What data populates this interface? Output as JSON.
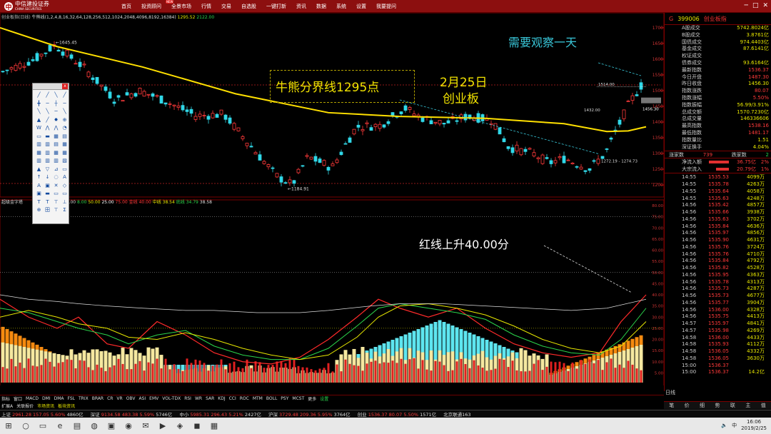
{
  "app": {
    "logo_cn": "中信建投证券",
    "logo_en": "CHINA SECURITIES",
    "menu": [
      "首页",
      "投资顾问",
      "全景市场",
      "行情",
      "交易",
      "自选股",
      "一键打新",
      "资讯",
      "数据",
      "系统",
      "设置",
      "我要提问"
    ],
    "menu_badge": "NEW",
    "win_buttons": [
      "─",
      "□",
      "✕"
    ]
  },
  "chart": {
    "param_line": {
      "name": "创业板指(日线)",
      "indicator": "牛熊线(1,2,4,8,16,32,64,128,256,512,1024,2048,4096,8192,16384)",
      "v1": "1295.52",
      "v2": "2122.00"
    },
    "price_axis": [
      "1700",
      "1650",
      "1600",
      "1550",
      "1500",
      "1450",
      "1400",
      "1350",
      "1300",
      "1250",
      "1200"
    ],
    "price_labels": {
      "high_mark": "1645.45",
      "low_mark": "1184.91",
      "l1514": "1514.00",
      "l1432": "1432.00",
      "l1456": "1456.30",
      "range": "1272.19 - 1274.73"
    },
    "ind_line": {
      "name": "超级金字塔",
      "a": "12.00",
      "b": "8.00",
      "c": "50.00",
      "d": "25.00",
      "e": "75.00",
      "gold_label": "金线",
      "gold_val": "40.00",
      "mid_label": "中线",
      "mid_val": "38.54",
      "low_label": "底线",
      "low_val": "34.79",
      "x": "38.58"
    },
    "ind_axis": [
      "80.00",
      "75.00",
      "70.00",
      "65.00",
      "60.00",
      "55.00",
      "50.00",
      "45.00",
      "40.00",
      "35.00",
      "30.00",
      "25.00",
      "20.00",
      "15.00",
      "10.00",
      "5.00"
    ],
    "date_marks": [
      "12",
      "1",
      "2"
    ]
  },
  "annotations": {
    "box_text": "牛熊分界线1295点",
    "date_text": "2月25日",
    "board_text": "创业板",
    "observe_text": "需要观察一天",
    "red_line_text": "红线上升40.00分"
  },
  "drawtool": {
    "close": "x",
    "tools": [
      "╱",
      "╱",
      "╲",
      "╱",
      "╋",
      "─",
      "┼",
      "─",
      "╲",
      "╲",
      "─",
      "╲",
      "▲",
      "╱",
      "✸",
      "⊕",
      "W",
      "⋀",
      "⋀",
      "◔",
      "▭",
      "▬",
      "▦",
      "▤",
      "▥",
      "▥",
      "▤",
      "▦",
      "▦",
      "▥",
      "▦",
      "▦",
      "▥",
      "▥",
      "▥",
      "▧",
      "▲",
      "▽",
      "⊿",
      "▭",
      "↑",
      "↓",
      "◌",
      "A",
      "A",
      "▣",
      "✕",
      "◇",
      "▣",
      "▬",
      "▭",
      "▭",
      "T",
      "T",
      "⊤",
      "⊥",
      "⊕",
      "田",
      "⊤",
      "Σ"
    ]
  },
  "quote": {
    "code": "399006",
    "name": "创业板指",
    "g": "G",
    "rows": [
      {
        "l": "A股成交",
        "v": "5742.8024亿",
        "c": ""
      },
      {
        "l": "B股成交",
        "v": "3.8761亿",
        "c": ""
      },
      {
        "l": "国债成交",
        "v": "974.4403亿",
        "c": ""
      },
      {
        "l": "基金成交",
        "v": "87.6141亿",
        "c": ""
      },
      {
        "l": "权证成交",
        "v": "",
        "c": ""
      },
      {
        "l": "债券成交",
        "v": "93.6164亿",
        "c": ""
      },
      {
        "l": "最新指数",
        "v": "1536.37",
        "c": "red"
      },
      {
        "l": "今日开盘",
        "v": "1487.30",
        "c": "red"
      },
      {
        "l": "昨日收盘",
        "v": "1456.30",
        "c": ""
      },
      {
        "l": "指数涨跌",
        "v": "80.07",
        "c": "red"
      },
      {
        "l": "指数涨幅",
        "v": "5.50%",
        "c": "red"
      },
      {
        "l": "指数振幅",
        "v": "56.99/3.91%",
        "c": ""
      },
      {
        "l": "总成交额",
        "v": "1570.7230亿",
        "c": ""
      },
      {
        "l": "总成交量",
        "v": "146336606",
        "c": ""
      },
      {
        "l": "最高指数",
        "v": "1538.16",
        "c": "red"
      },
      {
        "l": "最低指数",
        "v": "1481.17",
        "c": "red"
      },
      {
        "l": "指数量比",
        "v": "1.51",
        "c": ""
      },
      {
        "l": "深证换手",
        "v": "4.04%",
        "c": ""
      }
    ],
    "updown": {
      "rise_label": "涨家数",
      "rise": "739",
      "fall_label": "跌家数",
      "fall": "2"
    },
    "flows": [
      {
        "l": "净流入额",
        "v": "36.75亿",
        "p": "2%"
      },
      {
        "l": "大宗流入",
        "v": "20.79亿",
        "p": "1%"
      }
    ],
    "ticks": [
      {
        "t": "14:55",
        "p": "1535.53",
        "v": "4099万"
      },
      {
        "t": "14:55",
        "p": "1535.78",
        "v": "4263万"
      },
      {
        "t": "14:55",
        "p": "1535.64",
        "v": "4058万"
      },
      {
        "t": "14:55",
        "p": "1535.63",
        "v": "4248万"
      },
      {
        "t": "14:56",
        "p": "1535.42",
        "v": "4857万"
      },
      {
        "t": "14:56",
        "p": "1535.66",
        "v": "3938万"
      },
      {
        "t": "14:56",
        "p": "1535.63",
        "v": "3702万"
      },
      {
        "t": "14:56",
        "p": "1535.84",
        "v": "4636万"
      },
      {
        "t": "14:56",
        "p": "1535.97",
        "v": "4856万"
      },
      {
        "t": "14:56",
        "p": "1535.90",
        "v": "4631万"
      },
      {
        "t": "14:56",
        "p": "1535.76",
        "v": "3724万"
      },
      {
        "t": "14:56",
        "p": "1535.76",
        "v": "4710万"
      },
      {
        "t": "14:56",
        "p": "1535.84",
        "v": "4792万"
      },
      {
        "t": "14:56",
        "p": "1535.82",
        "v": "4528万"
      },
      {
        "t": "14:56",
        "p": "1535.95",
        "v": "4363万"
      },
      {
        "t": "14:56",
        "p": "1535.78",
        "v": "4313万"
      },
      {
        "t": "14:56",
        "p": "1535.73",
        "v": "4287万"
      },
      {
        "t": "14:56",
        "p": "1535.73",
        "v": "4677万"
      },
      {
        "t": "14:56",
        "p": "1535.77",
        "v": "3904万"
      },
      {
        "t": "14:56",
        "p": "1536.00",
        "v": "4328万"
      },
      {
        "t": "14:56",
        "p": "1535.75",
        "v": "4413万"
      },
      {
        "t": "14:57",
        "p": "1535.97",
        "v": "4841万"
      },
      {
        "t": "14:57",
        "p": "1535.98",
        "v": "4269万"
      },
      {
        "t": "14:58",
        "p": "1536.00",
        "v": "4433万"
      },
      {
        "t": "14:58",
        "p": "1535.93",
        "v": "4112万"
      },
      {
        "t": "14:58",
        "p": "1536.05",
        "v": "4332万"
      },
      {
        "t": "14:58",
        "p": "1536.05",
        "v": "3630万"
      },
      {
        "t": "15:00",
        "p": "1536.37",
        "v": ""
      },
      {
        "t": "15:00",
        "p": "1536.37",
        "v": "14.2亿"
      }
    ],
    "day_tab": "日线",
    "mini_tab": "横析",
    "bottom_tabs": [
      "笔",
      "价",
      "细",
      "势",
      "联",
      "主",
      "值"
    ]
  },
  "ind_tabs": [
    "指标",
    "窗口",
    "MACD",
    "DMI",
    "DMA",
    "FSL",
    "TRIX",
    "BRAR",
    "CR",
    "VR",
    "OBV",
    "ASI",
    "EMV",
    "VOL-TDX",
    "RSI",
    "WR",
    "SAR",
    "KDJ",
    "CCI",
    "ROC",
    "MTM",
    "BOLL",
    "PSY",
    "MCST",
    "更多",
    "设置"
  ],
  "link_tabs": [
    "扩展A",
    "关联报价",
    "市场资讯",
    "板块资讯"
  ],
  "ticker": [
    {
      "n": "上证",
      "v": "2961.28",
      "c": "157.05",
      "p": "5.60%",
      "a": "4860亿"
    },
    {
      "n": "深证",
      "v": "9134.58",
      "c": "483.38",
      "p": "5.59%",
      "a": "5746亿"
    },
    {
      "n": "中小",
      "v": "5985.31",
      "c": "296.43",
      "p": "5.21%",
      "a": "2427亿"
    },
    {
      "n": "沪深",
      "v": "3729.48",
      "c": "209.36",
      "p": "5.95%",
      "a": "3764亿"
    },
    {
      "n": "创业",
      "v": "1536.37",
      "c": "80.07",
      "p": "5.50%",
      "a": "1571亿"
    }
  ],
  "ticker_tail": "北京联通163",
  "taskbar": {
    "time": "16:06",
    "date": "2019/2/25",
    "lang": "中",
    "icons": [
      "⊞",
      "○",
      "▭",
      "e",
      "▤",
      "◍",
      "▣",
      "◉",
      "✉",
      "▶",
      "◈",
      "◼",
      "▦"
    ]
  },
  "colors": {
    "up": "#ff3a3a",
    "down": "#24d24a",
    "yellow": "#e8e800",
    "cyan": "#39c6d8",
    "frame": "#7a0000"
  }
}
